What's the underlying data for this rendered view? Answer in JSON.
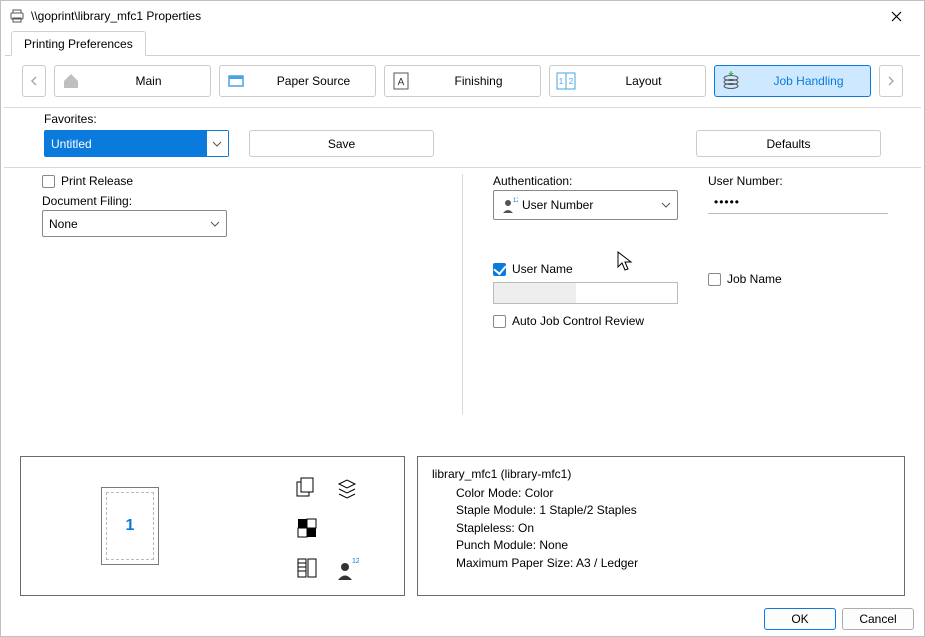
{
  "window": {
    "title": "\\\\goprint\\library_mfc1 Properties"
  },
  "tab": {
    "label": "Printing Preferences"
  },
  "categories": {
    "items": [
      {
        "label": "Main"
      },
      {
        "label": "Paper Source"
      },
      {
        "label": "Finishing"
      },
      {
        "label": "Layout"
      },
      {
        "label": "Job Handling",
        "active": true
      }
    ]
  },
  "favorites": {
    "label": "Favorites:",
    "value": "Untitled",
    "save": "Save",
    "defaults": "Defaults"
  },
  "left": {
    "print_release": "Print Release",
    "doc_filing_label": "Document Filing:",
    "doc_filing_value": "None"
  },
  "auth": {
    "label": "Authentication:",
    "value": "User Number",
    "usernum_label": "User Number:",
    "usernum_value": "•••••",
    "username_chk": "User Name",
    "jobname_chk": "Job Name",
    "autojob_chk": "Auto Job Control Review"
  },
  "preview": {
    "page_num": "1",
    "device": "library_mfc1 (library-mfc1)",
    "lines": {
      "color": "Color Mode: Color",
      "staple": "Staple Module: 1 Staple/2 Staples",
      "stapleless": "Stapleless: On",
      "punch": "Punch Module: None",
      "paper": "Maximum Paper Size: A3 / Ledger"
    }
  },
  "footer": {
    "ok": "OK",
    "cancel": "Cancel"
  }
}
